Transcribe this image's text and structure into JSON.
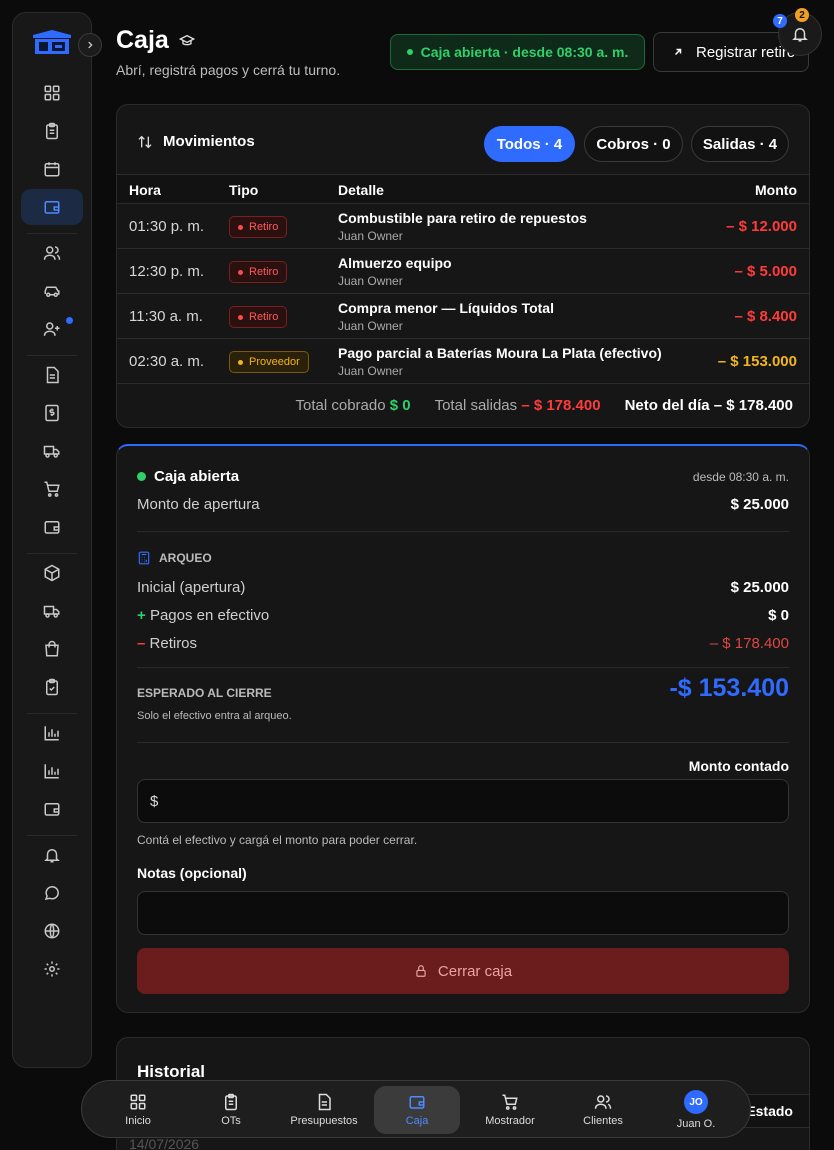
{
  "header": {
    "title": "Caja",
    "subtitle": "Abrí, registrá pagos y cerrá tu turno.",
    "status": "Caja abierta · desde 08:30 a. m.",
    "action_label": "Registrar retiro",
    "notif_count_blue": "7",
    "notif_count_orange": "2"
  },
  "movements": {
    "title": "Movimientos",
    "filters": [
      "Todos · 4",
      "Cobros · 0",
      "Salidas · 4"
    ],
    "columns": [
      "Hora",
      "Tipo",
      "Detalle",
      "Monto"
    ],
    "rows": [
      {
        "hora": "01:30 p. m.",
        "tipo": "Retiro",
        "detalle": "Combustible para retiro de repuestos",
        "usuario": "Juan Owner",
        "monto": "– $ 12.000"
      },
      {
        "hora": "12:30 p. m.",
        "tipo": "Retiro",
        "detalle": "Almuerzo equipo",
        "usuario": "Juan Owner",
        "monto": "– $ 5.000"
      },
      {
        "hora": "11:30 a. m.",
        "tipo": "Retiro",
        "detalle": "Compra menor — Líquidos Total",
        "usuario": "Juan Owner",
        "monto": "– $ 8.400"
      },
      {
        "hora": "02:30 a. m.",
        "tipo": "Proveedor",
        "detalle": "Pago parcial a Baterías Moura La Plata (efectivo)",
        "usuario": "Juan Owner",
        "monto": "– $ 153.000"
      }
    ],
    "totals": {
      "cobrado_label": "Total cobrado",
      "cobrado_value": "$ 0",
      "salidas_label": "Total salidas",
      "salidas_value": "– $ 178.400",
      "neto_label": "Neto del día",
      "neto_value": "– $ 178.400"
    }
  },
  "caja": {
    "status": "Caja abierta",
    "since": "desde 08:30 a. m.",
    "apertura_label": "Monto de apertura",
    "apertura_value": "$ 25.000",
    "arqueo_title": "ARQUEO",
    "inicial_label": "Inicial (apertura)",
    "inicial_value": "$ 25.000",
    "pagos_sign": "+",
    "pagos_label": "Pagos en efectivo",
    "pagos_value": "$ 0",
    "retiros_sign": "–",
    "retiros_label": "Retiros",
    "retiros_value": "– $ 178.400",
    "esperado_label": "ESPERADO AL CIERRE",
    "esperado_note": "Solo el efectivo entra al arqueo.",
    "esperado_value": "-$ 153.400",
    "monto_label": "Monto contado",
    "monto_prefix": "$",
    "monto_hint": "Contá el efectivo y cargá el monto para poder cerrar.",
    "notas_label": "Notas (opcional)",
    "close_label": "Cerrar caja"
  },
  "historial": {
    "title": "Historial",
    "estado_header": "Estado",
    "first_date": "14/07/2026"
  },
  "bottom_nav": {
    "items": [
      "Inicio",
      "OTs",
      "Presupuestos",
      "Caja",
      "Mostrador",
      "Clientes",
      "Juan O."
    ],
    "avatar_initials": "JO"
  },
  "colors": {
    "accent": "#2f6bff",
    "success": "#2fd06b",
    "danger": "#ff3b3b",
    "warning": "#f2b51e"
  }
}
